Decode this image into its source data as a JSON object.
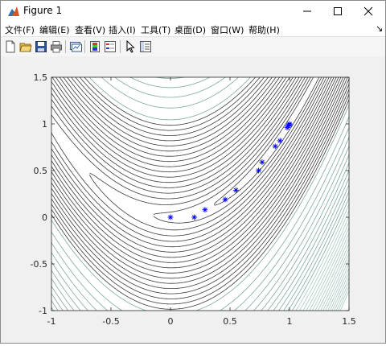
{
  "window": {
    "title": "Figure 1",
    "icons": {
      "app": "matlab-figure-icon",
      "minimize": "minimize-icon",
      "maximize": "maximize-icon",
      "close": "close-icon"
    }
  },
  "menubar": {
    "items": [
      {
        "label": "文件(F)"
      },
      {
        "label": "编辑(E)"
      },
      {
        "label": "查看(V)"
      },
      {
        "label": "插入(I)"
      },
      {
        "label": "工具(T)"
      },
      {
        "label": "桌面(D)"
      },
      {
        "label": "窗口(W)"
      },
      {
        "label": "帮助(H)"
      }
    ],
    "dock_arrow": "↘"
  },
  "toolbar": {
    "buttons": [
      "new-figure-icon",
      "open-file-icon",
      "save-icon",
      "print-icon",
      "link-plot-icon",
      "colorbar-icon",
      "legend-icon",
      "edit-plot-arrow-icon",
      "property-inspector-icon"
    ]
  },
  "colors": {
    "marker": "#0000ff",
    "contour": "#3a3a3a",
    "axes_bg": "#ffffff",
    "figure_bg": "#f0f0f0"
  },
  "chart_data": {
    "type": "scatter",
    "title": "",
    "xlabel": "",
    "ylabel": "",
    "xlim": [
      -1,
      1.5
    ],
    "ylim": [
      -1,
      1.5
    ],
    "xticks": [
      -1,
      -0.5,
      0,
      0.5,
      1,
      1.5
    ],
    "xtick_labels": [
      "-1",
      "-0.5",
      "0",
      "0.5",
      "1",
      "1.5"
    ],
    "yticks": [
      -1,
      -0.5,
      0,
      0.5,
      1,
      1.5
    ],
    "ytick_labels": [
      "-1",
      "-0.5",
      "0",
      "0.5",
      "1",
      "1.5"
    ],
    "background": "contour plot of Rosenbrock-like valley function",
    "series": [
      {
        "marker": "*",
        "color": "#0000ff",
        "x": [
          0,
          0.2,
          0.29,
          0.46,
          0.55,
          0.74,
          0.77,
          0.88,
          0.92,
          0.98,
          0.99,
          1.0,
          1.0
        ],
        "y": [
          0,
          0,
          0.08,
          0.19,
          0.29,
          0.5,
          0.59,
          0.76,
          0.82,
          0.96,
          0.98,
          0.99,
          1.0
        ]
      }
    ]
  }
}
